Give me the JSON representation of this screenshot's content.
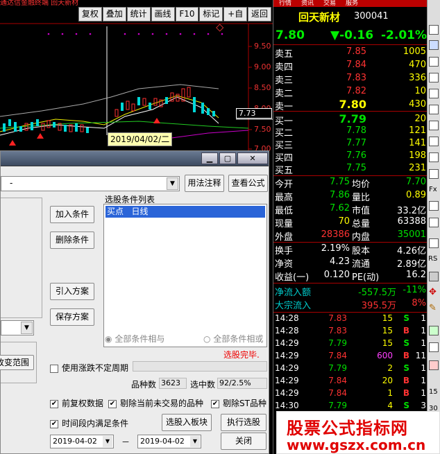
{
  "chart_top": {
    "title_text": "通达信金融终端 回天新材",
    "toolbar": [
      "复权",
      "叠加",
      "统计",
      "画线",
      "F10",
      "标记",
      "+自选",
      "返回"
    ],
    "y_ticks": [
      "9.50",
      "9.00",
      "8.50",
      "8.00",
      "7.50",
      "7.00"
    ],
    "price_tag": "7.73",
    "date_tip": "2019/04/02/二"
  },
  "dialog": {
    "formula_value": "-",
    "usage_btn": "用法注释",
    "view_formula_btn": "查看公式",
    "list_title": "选股条件列表",
    "list_item": "买点   日线",
    "add_btn": "加入条件",
    "delete_btn": "删除条件",
    "import_btn": "引入方案",
    "save_btn": "保存方案",
    "range_btn": "改变范围",
    "radio_and": "全部条件相与",
    "radio_or": "全部条件相或",
    "status": "选股完毕.",
    "uncertain_period": "使用涨跌不定周期",
    "count_label": "品种数",
    "count_value": "3623",
    "selected_label": "选中数",
    "selected_value": "92/2.5%",
    "opt_prefuquan": "前复权数据",
    "opt_exclude_halt": "剔除当前未交易的品种",
    "opt_exclude_st": "剔除ST品种",
    "opt_period": "时间段内满足条件",
    "to_block_btn": "选股入板块",
    "run_btn": "执行选股",
    "close_btn": "关闭",
    "date_from": "2019-04-02",
    "date_sep": "－",
    "date_to": "2019-04-02"
  },
  "quote": {
    "name": "回天新材",
    "code": "300041",
    "price": "7.80",
    "change": "▼-0.16",
    "pct": "-2.01%",
    "sell": [
      {
        "label": "卖五",
        "price": "7.85",
        "vol": "1005"
      },
      {
        "label": "卖四",
        "price": "7.84",
        "vol": "470"
      },
      {
        "label": "卖三",
        "price": "7.83",
        "vol": "336"
      },
      {
        "label": "卖二",
        "price": "7.82",
        "vol": "10"
      },
      {
        "label": "卖一",
        "price": "7.80",
        "vol": "430"
      }
    ],
    "buy": [
      {
        "label": "买一",
        "price": "7.79",
        "vol": "20"
      },
      {
        "label": "买二",
        "price": "7.78",
        "vol": "121"
      },
      {
        "label": "买三",
        "price": "7.77",
        "vol": "141"
      },
      {
        "label": "买四",
        "price": "7.76",
        "vol": "198"
      },
      {
        "label": "买五",
        "price": "7.75",
        "vol": "231"
      }
    ],
    "stats": [
      {
        "l1": "今开",
        "v1": "7.75",
        "l2": "均价",
        "v2": "7.70"
      },
      {
        "l1": "最高",
        "v1": "7.86",
        "l2": "量比",
        "v2": "0.89"
      },
      {
        "l1": "最低",
        "v1": "7.62",
        "l2": "市值",
        "v2": "33.2亿"
      },
      {
        "l1": "现量",
        "v1": "70",
        "l2": "总量",
        "v2": "63388"
      },
      {
        "l1": "外盘",
        "v1": "28386",
        "l2": "内盘",
        "v2": "35001"
      },
      {
        "l1": "换手",
        "v1": "2.19%",
        "l2": "股本",
        "v2": "4.26亿"
      },
      {
        "l1": "净资",
        "v1": "4.23",
        "l2": "流通",
        "v2": "2.89亿"
      },
      {
        "l1": "收益(一)",
        "v1": "0.120",
        "l2": "PE(动)",
        "v2": "16.2"
      }
    ],
    "netflow_label": "净流入额",
    "netflow_value": "-557.5万",
    "netflow_pct": "-11%",
    "block_label": "大宗流入",
    "block_value": "395.5万",
    "block_pct": "8%",
    "ticks": [
      {
        "t": "14:28",
        "p": "7.83",
        "v": "15",
        "s": "S",
        "n": "1"
      },
      {
        "t": "14:28",
        "p": "7.83",
        "v": "15",
        "s": "B",
        "n": "1"
      },
      {
        "t": "14:29",
        "p": "7.79",
        "v": "15",
        "s": "S",
        "n": "1"
      },
      {
        "t": "14:29",
        "p": "7.84",
        "v": "600",
        "s": "B",
        "n": "11"
      },
      {
        "t": "14:29",
        "p": "7.79",
        "v": "2",
        "s": "S",
        "n": "1"
      },
      {
        "t": "14:29",
        "p": "7.84",
        "v": "20",
        "s": "B",
        "n": "1"
      },
      {
        "t": "14:29",
        "p": "7.84",
        "v": "1",
        "s": "B",
        "n": "1"
      },
      {
        "t": "14:30",
        "p": "7.79",
        "v": "4",
        "s": "S",
        "n": "3"
      }
    ]
  },
  "watermark": {
    "title": "股票公式指标网",
    "url": "www.gszx.com.cn"
  },
  "side_labels": [
    "行情",
    "资讯",
    "交易",
    "服务"
  ],
  "strip_labels": [
    "RS",
    "Fx",
    "15",
    "30"
  ]
}
